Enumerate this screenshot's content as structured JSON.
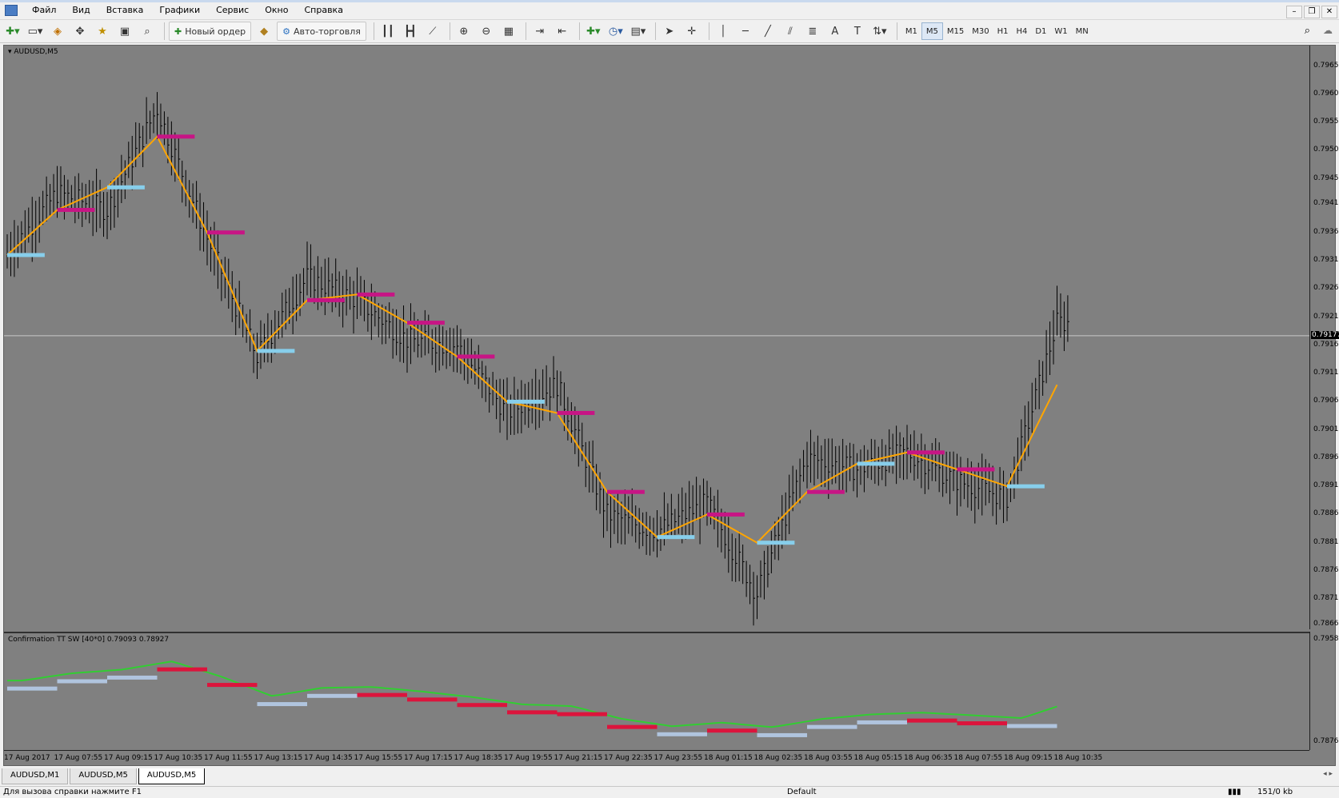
{
  "menu": {
    "items": [
      "Файл",
      "Вид",
      "Вставка",
      "Графики",
      "Сервис",
      "Окно",
      "Справка"
    ]
  },
  "toolbar": {
    "new_order_label": "Новый ордер",
    "autotrading_label": "Авто-торговля",
    "timeframes": [
      "M1",
      "M5",
      "M15",
      "M30",
      "H1",
      "H4",
      "D1",
      "W1",
      "MN"
    ],
    "active_timeframe": "M5"
  },
  "chart": {
    "symbol_label": "AUDUSD,M5",
    "current_price": "0.79177",
    "price_ticks": [
      "0.79655",
      "0.79605",
      "0.79555",
      "0.79505",
      "0.79455",
      "0.79410",
      "0.79360",
      "0.79310",
      "0.79260",
      "0.79210",
      "0.79160",
      "0.79110",
      "0.79060",
      "0.79010",
      "0.78960",
      "0.78910",
      "0.78860",
      "0.78810",
      "0.78760",
      "0.78710",
      "0.78665"
    ],
    "time_ticks": [
      "17 Aug 2017",
      "17 Aug 07:55",
      "17 Aug 09:15",
      "17 Aug 10:35",
      "17 Aug 11:55",
      "17 Aug 13:15",
      "17 Aug 14:35",
      "17 Aug 15:55",
      "17 Aug 17:15",
      "17 Aug 18:35",
      "17 Aug 19:55",
      "17 Aug 21:15",
      "17 Aug 22:35",
      "17 Aug 23:55",
      "18 Aug 01:15",
      "18 Aug 02:35",
      "18 Aug 03:55",
      "18 Aug 05:15",
      "18 Aug 06:35",
      "18 Aug 07:55",
      "18 Aug 09:15",
      "18 Aug 10:35"
    ],
    "colors": {
      "background": "#808080",
      "bars": "#000000",
      "ma_line": "#ffa500",
      "level_up": "#87ceeb",
      "level_down": "#c71585",
      "indicator_line": "#32cd32",
      "indicator_up": "#b0c4de",
      "indicator_down": "#dc143c"
    }
  },
  "indicator": {
    "label": "Confirmation TT SW [40*0] 0.79093 0.78927",
    "axis_top": "0.79582",
    "axis_bottom": "0.78761"
  },
  "tabs": [
    "AUDUSD,M1",
    "AUDUSD,M5",
    "AUDUSD,M5"
  ],
  "active_tab": 2,
  "status": {
    "help_text": "Для вызова справки нажмите F1",
    "profile": "Default",
    "traffic": "151/0 kb"
  },
  "chart_data": {
    "type": "line",
    "title": "",
    "xlabel": "",
    "ylabel": "",
    "ylim": [
      0.78665,
      0.7968
    ],
    "categories": [
      "17 Aug 2017",
      "17 Aug 07:55",
      "17 Aug 09:15",
      "17 Aug 10:35",
      "17 Aug 11:55",
      "17 Aug 13:15",
      "17 Aug 14:35",
      "17 Aug 15:55",
      "17 Aug 17:15",
      "17 Aug 18:35",
      "17 Aug 19:55",
      "17 Aug 21:15",
      "17 Aug 22:35",
      "17 Aug 23:55",
      "18 Aug 01:15",
      "18 Aug 02:35",
      "18 Aug 03:55",
      "18 Aug 05:15",
      "18 Aug 06:35",
      "18 Aug 07:55",
      "18 Aug 09:15",
      "18 Aug 10:35"
    ],
    "series": [
      {
        "values": [
          0.7932,
          0.794,
          0.7944,
          0.7953,
          0.7936,
          0.7915,
          0.7924,
          0.7925,
          0.792,
          0.7914,
          0.7906,
          0.7904,
          0.789,
          0.7882,
          0.7886,
          0.7881,
          0.789,
          0.7895,
          0.7897,
          0.7894,
          0.7891,
          0.7909
        ]
      },
      {
        "values": [
          0.7932,
          0.7943,
          0.794,
          0.7958,
          0.7935,
          0.7914,
          0.7928,
          0.7924,
          0.7917,
          0.7916,
          0.7904,
          0.7909,
          0.7886,
          0.7883,
          0.7888,
          0.7872,
          0.7896,
          0.7894,
          0.7897,
          0.7892,
          0.7889,
          0.792
        ]
      }
    ]
  }
}
